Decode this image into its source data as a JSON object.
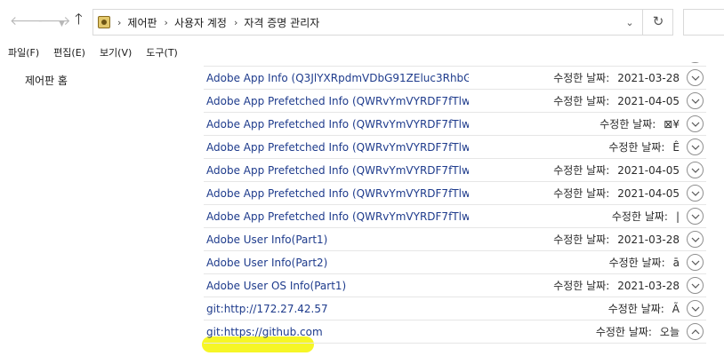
{
  "nav": {
    "back_icon": "arrow-left-icon",
    "forward_icon": "arrow-right-icon",
    "recent_icon": "chevron-down-icon",
    "up_icon": "arrow-up-icon"
  },
  "breadcrumb": [
    "제어판",
    "사용자 계정",
    "자격 증명 관리자"
  ],
  "menu": [
    "파일(F)",
    "편집(E)",
    "보기(V)",
    "도구(T)"
  ],
  "left_pane": {
    "home_link": "제어판 홈"
  },
  "list": {
    "modified_label": "수정한 날짜:",
    "rows": [
      {
        "name": "Adobe App Info (Q3JlYXRpdmVDbG91ZEluc3RhbGxl...",
        "date": "|",
        "expanded": false
      },
      {
        "name": "Adobe App Info (Q3JlYXRpdmVDbG91ZEluc3RhbGxl...",
        "date": "2021-03-28",
        "expanded": false
      },
      {
        "name": "Adobe App Prefetched Info (QWRvYmVYRDF7fTlwM...",
        "date": "2021-04-05",
        "expanded": false
      },
      {
        "name": "Adobe App Prefetched Info (QWRvYmVYRDF7fTlwM...",
        "date": "⊠¥",
        "expanded": false
      },
      {
        "name": "Adobe App Prefetched Info (QWRvYmVYRDF7fTlwM...",
        "date": "Ê",
        "expanded": false
      },
      {
        "name": "Adobe App Prefetched Info (QWRvYmVYRDF7fTlwM...",
        "date": "2021-04-05",
        "expanded": false
      },
      {
        "name": "Adobe App Prefetched Info (QWRvYmVYRDF7fTlwM...",
        "date": "2021-04-05",
        "expanded": false
      },
      {
        "name": "Adobe App Prefetched Info (QWRvYmVYRDF7fTlwM...",
        "date": "|",
        "expanded": false
      },
      {
        "name": "Adobe User Info(Part1)",
        "date": "2021-03-28",
        "expanded": false
      },
      {
        "name": "Adobe User Info(Part2)",
        "date": "ā",
        "expanded": false
      },
      {
        "name": "Adobe User OS Info(Part1)",
        "date": "2021-03-28",
        "expanded": false
      },
      {
        "name": "git:http://172.27.42.57",
        "date": "Ã",
        "expanded": false
      },
      {
        "name": "git:https://github.com",
        "date": "오늘",
        "expanded": true
      }
    ]
  },
  "highlight_color": "#f5f500"
}
